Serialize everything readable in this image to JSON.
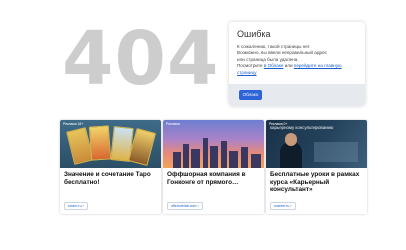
{
  "error_code": "404",
  "dialog": {
    "title": "Ошибка",
    "line1": "К сожалению, такой страницы нет.",
    "line2": "Возможно, вы ввели неправильный адрес",
    "line3": "или страница была удалена.",
    "line4_prefix": "Посмотрите ",
    "link_cloud": "в Облаке",
    "line4_mid": " или ",
    "link_home": "перейдите на главную",
    "link_home2": "страницу",
    "ok_button": "Облако"
  },
  "cards": [
    {
      "tag": "Реклама 18+",
      "title": "Значение и сочетание Таро бесплатно!",
      "site": "rutaro.ru ›"
    },
    {
      "tag": "Реклама",
      "title": "Оффшорная компания в Гонконге от прямого…",
      "site": "offshorelab.com ›"
    },
    {
      "tag": "Реклама 0+",
      "banner": "карьерному консультированию",
      "title": "Бесплатные уроки в рамках курса «Карьерный консультант»",
      "site": "rcareer.ru ›"
    }
  ]
}
